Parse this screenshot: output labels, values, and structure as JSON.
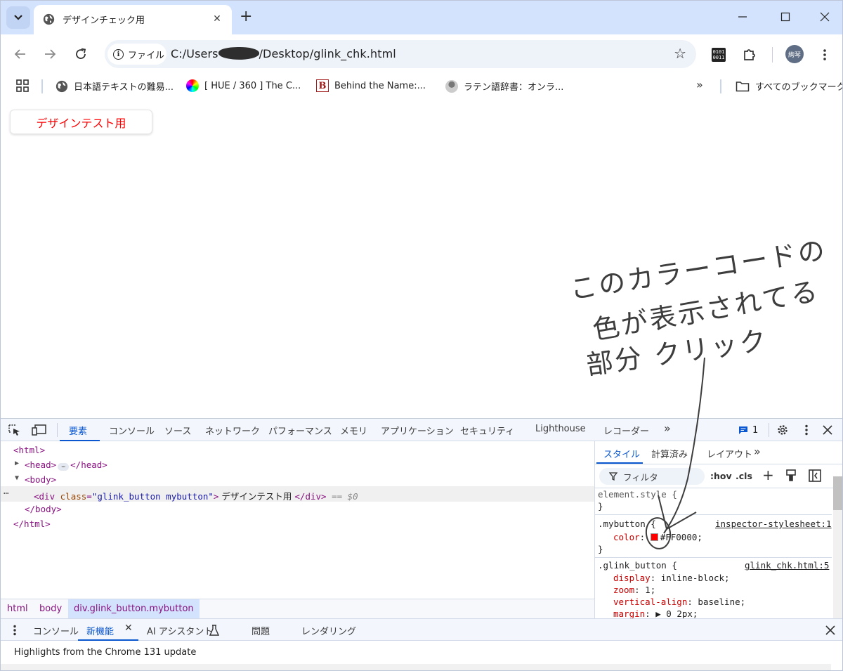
{
  "browser": {
    "tab_title": "デザインチェック用",
    "omnibox": {
      "chip_label": "ファイル",
      "url_prefix": "C:/Users",
      "url_suffix": "/Desktop/glink_chk.html"
    },
    "profile_initials": "絢琴",
    "bookmarks": [
      {
        "label": "日本語テキストの難易..."
      },
      {
        "label": "[ HUE / 360 ] The C..."
      },
      {
        "label": "Behind the Name:..."
      },
      {
        "label": "ラテン語辞書：オンラ..."
      }
    ],
    "all_bookmarks_label": "すべてのブックマーク"
  },
  "page": {
    "button_label": "デザインテスト用",
    "button_color": "#ff0000"
  },
  "devtools": {
    "tabs": [
      "要素",
      "コンソール",
      "ソース",
      "ネットワーク",
      "パフォーマンス",
      "メモリ",
      "アプリケーション",
      "セキュリティ",
      "Lighthouse",
      "レコーダー"
    ],
    "issues_count": "1",
    "dom": {
      "html_open": "<html>",
      "head_open": "<head>",
      "head_close": "</head>",
      "body_open": "<body>",
      "div_tag": "div",
      "div_attr_name": "class",
      "div_attr_value": "\"glink_button mybutton\"",
      "div_text": " デザインテスト用 ",
      "div_close": "</div>",
      "dollar": "== $0",
      "body_close": "</body>",
      "html_close": "</html>"
    },
    "breadcrumbs": [
      "html",
      "body",
      "div.glink_button.mybutton"
    ],
    "styles_tabs": [
      "スタイル",
      "計算済み",
      "レイアウト"
    ],
    "filter_placeholder": "フィルタ",
    "hov_label": ":hov",
    "cls_label": ".cls",
    "rules": {
      "element_style": "element.style {",
      "close": "}",
      "mybutton_selector": ".mybutton {",
      "mybutton_source": "inspector-stylesheet:1",
      "mybutton_prop": "color",
      "mybutton_value": "#FF0000;",
      "glink_selector": ".glink_button {",
      "glink_source": "glink_chk.html:5",
      "props": [
        {
          "name": "display",
          "value": "inline-block;"
        },
        {
          "name": "zoom",
          "value": "1;"
        },
        {
          "name": "vertical-align",
          "value": "baseline;"
        },
        {
          "name": "margin",
          "value": "▶ 0 2px;"
        }
      ]
    },
    "drawer_tabs": [
      "コンソール",
      "新機能",
      "AI アシスタント",
      "問題",
      "レンダリング"
    ],
    "drawer_message": "Highlights from the Chrome 131 update"
  },
  "annotation": {
    "line1": "このカラーコードの",
    "line2": "色が表示されてる",
    "line3": "部分 クリック",
    "color": "#3d3d3d"
  }
}
